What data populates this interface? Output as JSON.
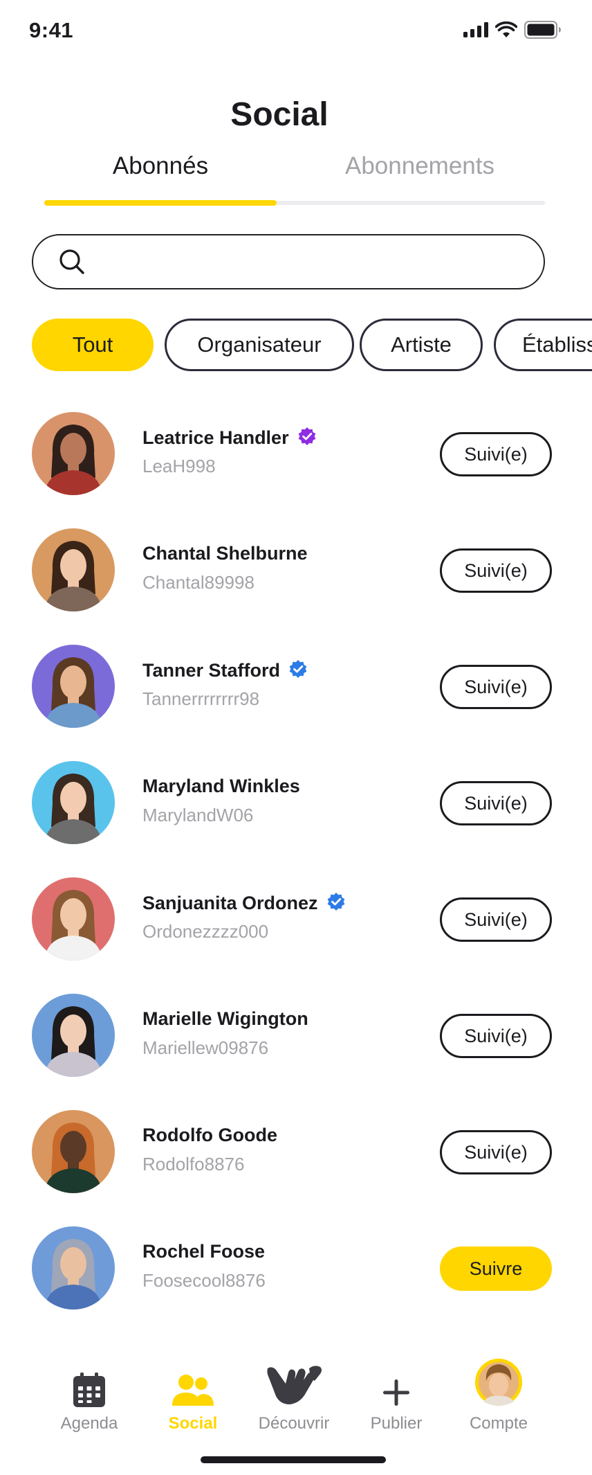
{
  "colors": {
    "accent": "#FFD600",
    "text": "#1B1B1F",
    "muted": "#A3A3A8",
    "verified_purple": "#8E2DE2",
    "verified_blue": "#2D7BE6"
  },
  "status_bar": {
    "time": "9:41",
    "icons": [
      "signal-icon",
      "wifi-icon",
      "battery-icon"
    ]
  },
  "header": {
    "title": "Social"
  },
  "tabs": [
    {
      "label": "Abonnés",
      "active": true
    },
    {
      "label": "Abonnements",
      "active": false
    }
  ],
  "search": {
    "placeholder": "",
    "value": "",
    "icon": "search-icon"
  },
  "filters": [
    {
      "label": "Tout",
      "selected": true
    },
    {
      "label": "Organisateur",
      "selected": false
    },
    {
      "label": "Artiste",
      "selected": false
    },
    {
      "label": "Établissement",
      "selected": false
    }
  ],
  "users": [
    {
      "name": "Leatrice Handler",
      "handle": "LeaH998",
      "verified": "purple",
      "button": "Suivi(e)",
      "following": true,
      "avatar_bg": "#D9936A",
      "skin": "#B9785A",
      "hair": "#2E1F1A",
      "shirt": "#A8342E"
    },
    {
      "name": "Chantal Shelburne",
      "handle": "Chantal89998",
      "verified": "",
      "button": "Suivi(e)",
      "following": true,
      "avatar_bg": "#D89A60",
      "skin": "#F0C7A8",
      "hair": "#3A2418",
      "shirt": "#7E6659"
    },
    {
      "name": "Tanner Stafford",
      "handle": "Tannerrrrrrrr98",
      "verified": "blue",
      "button": "Suivi(e)",
      "following": true,
      "avatar_bg": "#7B6BD8",
      "skin": "#E8B791",
      "hair": "#5A3A22",
      "shirt": "#6B9ACB"
    },
    {
      "name": "Maryland Winkles",
      "handle": "MarylandW06",
      "verified": "",
      "button": "Suivi(e)",
      "following": true,
      "avatar_bg": "#59C3EC",
      "skin": "#F2CBB0",
      "hair": "#3A2A20",
      "shirt": "#6D6D6D"
    },
    {
      "name": "Sanjuanita Ordonez",
      "handle": "Ordonezzzz000",
      "verified": "blue",
      "button": "Suivi(e)",
      "following": true,
      "avatar_bg": "#DF6F6F",
      "skin": "#F2C9A8",
      "hair": "#8A5A34",
      "shirt": "#F2F2F2"
    },
    {
      "name": "Marielle Wigington",
      "handle": "Mariellew09876",
      "verified": "",
      "button": "Suivi(e)",
      "following": true,
      "avatar_bg": "#6C9DD8",
      "skin": "#F1CDB5",
      "hair": "#1E1A1A",
      "shirt": "#C9C3CF"
    },
    {
      "name": "Rodolfo Goode",
      "handle": "Rodolfo8876",
      "verified": "",
      "button": "Suivi(e)",
      "following": true,
      "avatar_bg": "#D9965E",
      "skin": "#5B3A28",
      "hair": "#C86A2B",
      "shirt": "#1D3A2E"
    },
    {
      "name": "Rochel Foose",
      "handle": "Foosecool8876",
      "verified": "",
      "button": "Suivre",
      "following": false,
      "avatar_bg": "#6F9BD9",
      "skin": "#E9C0A0",
      "hair": "#9EA6B8",
      "shirt": "#4C73B8"
    }
  ],
  "bottom_nav": [
    {
      "label": "Agenda",
      "icon": "calendar-icon",
      "active": false
    },
    {
      "label": "Social",
      "icon": "users-icon",
      "active": true
    },
    {
      "label": "Découvrir",
      "icon": "shaka-hand-icon",
      "active": false
    },
    {
      "label": "Publier",
      "icon": "plus-icon",
      "active": false
    },
    {
      "label": "Compte",
      "icon": "account-avatar-icon",
      "active": false
    }
  ]
}
